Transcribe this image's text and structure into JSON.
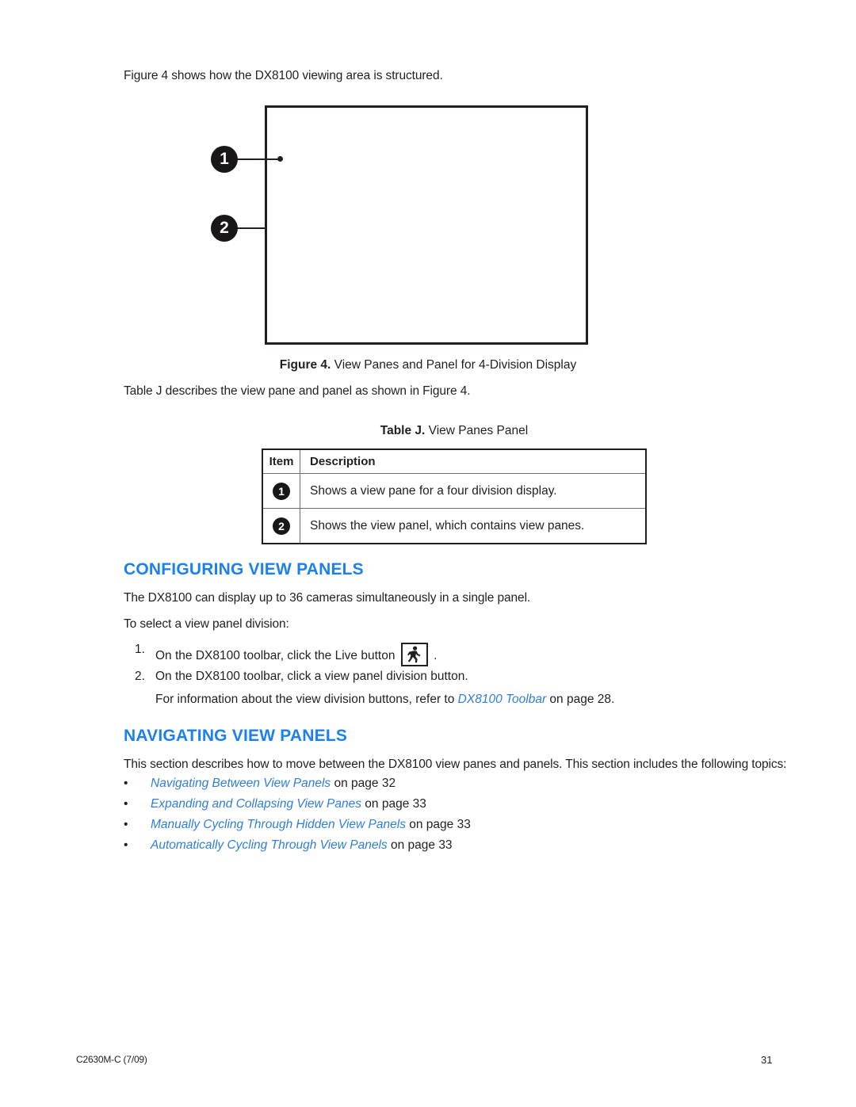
{
  "document": {
    "intro_line": "Figure 4 shows how the DX8100 viewing area is structured."
  },
  "figure": {
    "callouts": [
      {
        "number": "1"
      },
      {
        "number": "2"
      }
    ],
    "caption_label": "Figure 4.",
    "caption_text": "View Panes and Panel for 4-Division Display"
  },
  "table_intro": "Table J describes the view pane and panel as shown in Figure 4.",
  "table": {
    "caption_label": "Table J.",
    "caption_text": "View Panes Panel",
    "headers": [
      "Item",
      "Description"
    ],
    "rows": [
      {
        "item": "1",
        "description": "Shows a view pane for a four division display."
      },
      {
        "item": "2",
        "description": "Shows the view panel, which contains view panes."
      }
    ]
  },
  "configuring": {
    "heading": "CONFIGURING VIEW PANELS",
    "paragraph_1": "The DX8100 can display up to 36 cameras simultaneously in a single panel.",
    "paragraph_2": "To select a view panel division:",
    "step_1_number": "1.",
    "step_1_text_before": "On the DX8100 toolbar, click the Live button",
    "step_1_icon": "live-walking-person-icon",
    "step_1_text_after": ".",
    "step_2_number": "2.",
    "step_2_text": "On the DX8100 toolbar, click a view panel division button.",
    "step_2_note_before": "For information about the view division buttons, refer to ",
    "step_2_note_link": "DX8100 Toolbar",
    "step_2_note_after": " on page 28."
  },
  "navigating": {
    "heading": "NAVIGATING VIEW PANELS",
    "paragraph_1": "This section describes how to move between the DX8100 view panes and panels. This section includes the following topics:",
    "bullet_char": "•",
    "topics": [
      {
        "link": "Navigating Between View Panels",
        "suffix": " on page 32"
      },
      {
        "link": "Expanding and Collapsing View Panes",
        "suffix": " on page 33"
      },
      {
        "link": "Manually Cycling Through Hidden View Panels",
        "suffix": " on page 33"
      },
      {
        "link": "Automatically Cycling Through View Panels",
        "suffix": " on page 33"
      }
    ]
  },
  "footer": {
    "document_code": "C2630M-C (7/09)",
    "page_number": "31"
  },
  "colors": {
    "heading_blue": "#1c81ef",
    "link_blue": "#2f7ed8",
    "text_black": "#231f20",
    "rule_gray": "#6d6e71"
  }
}
